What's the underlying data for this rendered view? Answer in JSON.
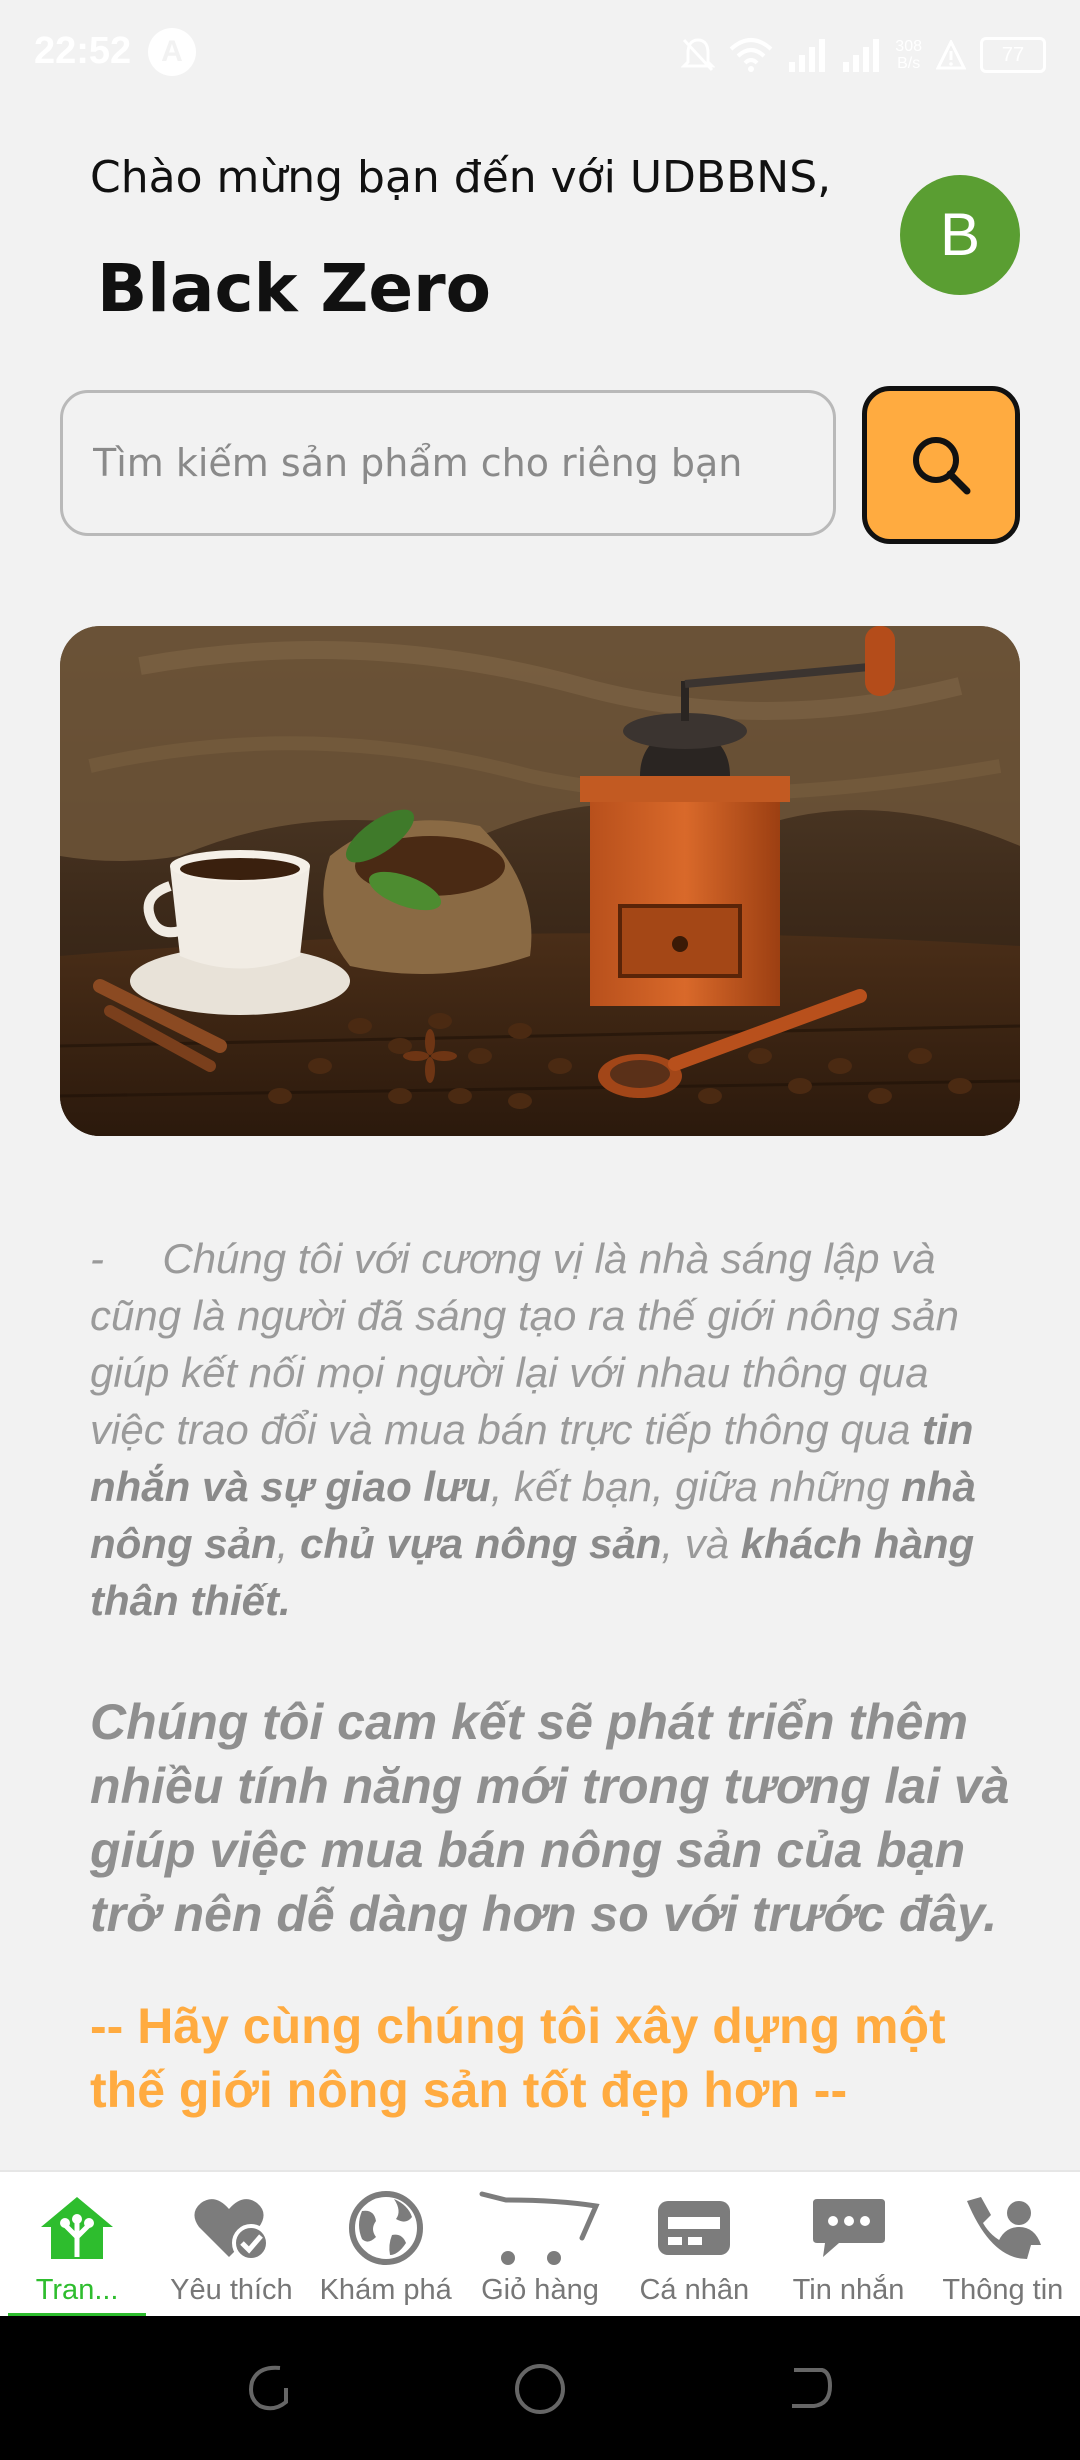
{
  "status_bar": {
    "time": "22:52",
    "notification_letter": "A",
    "net_speed_top": "308",
    "net_speed_bottom": "B/s",
    "battery": "77",
    "icons": [
      "bell-off-icon",
      "wifi-icon",
      "signal-icon",
      "signal-icon",
      "warning-icon",
      "battery-icon"
    ]
  },
  "header": {
    "greeting": "Chào mừng bạn đến với UDBBNS,",
    "username": "Black Zero",
    "avatar_letter": "B",
    "avatar_color": "#5a9e32"
  },
  "search": {
    "placeholder": "Tìm kiếm sản phẩm cho riêng bạn",
    "value": "",
    "button_color": "#ffab40",
    "icon": "search-icon"
  },
  "banner": {
    "subject": "coffee-banner"
  },
  "description": {
    "bullet": "-",
    "p1": "Chúng tôi với cương vị là nhà sáng lập và cũng là người đã sáng tạo ra thế giới nông sản giúp kết nối mọi người lại với nhau thông qua việc trao đổi và mua bán trực tiếp thông qua ",
    "b1": "tin nhắn và sự giao lưu",
    "p2": ", kết bạn, giữa những ",
    "b2": "nhà nông sản",
    "p3": ", ",
    "b3": "chủ vựa nông sản",
    "p4": ", và ",
    "b4": "khách hàng thân thiết."
  },
  "commitment": "Chúng tôi cam kết sẽ phát triển thêm nhiều tính năng mới trong tương lai và giúp việc mua bán nông sản của bạn trở nên dễ dàng hơn so với trước đây.",
  "slogan": "-- Hãy cùng chúng tôi xây dựng một thế giới nông sản tốt đẹp hơn --",
  "slogan_color": "#ffab40",
  "bottom_nav": {
    "active_color": "#2ebd2e",
    "items": [
      {
        "label": "Tran...",
        "icon": "home-icon"
      },
      {
        "label": "Yêu thích",
        "icon": "favorite-icon"
      },
      {
        "label": "Khám phá",
        "icon": "globe-icon"
      },
      {
        "label": "Giỏ hàng",
        "icon": "cart-icon"
      },
      {
        "label": "Cá nhân",
        "icon": "card-icon"
      },
      {
        "label": "Tin nhắn",
        "icon": "chat-icon"
      },
      {
        "label": "Thông tin",
        "icon": "contact-icon"
      }
    ]
  },
  "system_nav": {
    "icons": [
      "recents-icon",
      "home-circle-icon",
      "back-icon"
    ]
  }
}
